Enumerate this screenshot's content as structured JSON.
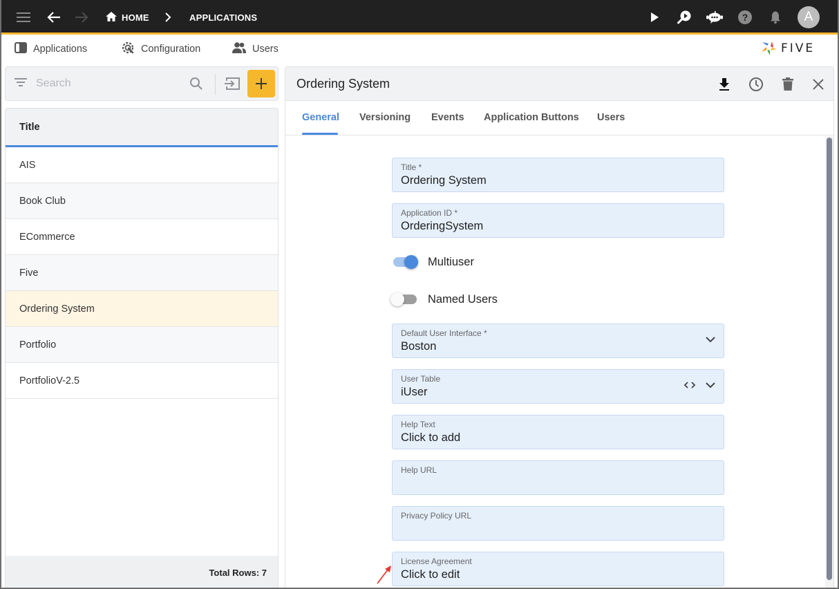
{
  "topbar": {
    "breadcrumb": [
      {
        "label": "HOME",
        "icon": "home-icon"
      },
      {
        "label": "APPLICATIONS"
      }
    ],
    "avatar_initial": "A",
    "icons": [
      "menu-icon",
      "back-arrow-icon",
      "forward-arrow-icon",
      "play-icon",
      "search-play-icon",
      "chat-bot-icon",
      "help-icon",
      "bell-icon"
    ]
  },
  "nav": {
    "items": [
      {
        "label": "Applications",
        "icon": "applications-icon"
      },
      {
        "label": "Configuration",
        "icon": "configuration-icon"
      },
      {
        "label": "Users",
        "icon": "users-icon"
      }
    ],
    "logo_text": "FIVE"
  },
  "list": {
    "search_placeholder": "Search",
    "column_header": "Title",
    "rows": [
      {
        "title": "AIS"
      },
      {
        "title": "Book Club"
      },
      {
        "title": "ECommerce"
      },
      {
        "title": "Five"
      },
      {
        "title": "Ordering System",
        "selected": true
      },
      {
        "title": "Portfolio"
      },
      {
        "title": "PortfolioV-2.5"
      }
    ],
    "footer": "Total Rows: 7"
  },
  "detail": {
    "title": "Ordering System",
    "tabs": [
      {
        "label": "General",
        "active": true
      },
      {
        "label": "Versioning"
      },
      {
        "label": "Events"
      },
      {
        "label": "Application Buttons"
      },
      {
        "label": "Users"
      }
    ],
    "fields": {
      "title": {
        "label": "Title *",
        "value": "Ordering System"
      },
      "app_id": {
        "label": "Application ID *",
        "value": "OrderingSystem"
      },
      "multiuser": {
        "label": "Multiuser",
        "on": true
      },
      "named_users": {
        "label": "Named Users",
        "on": false
      },
      "default_ui": {
        "label": "Default User Interface *",
        "value": "Boston"
      },
      "user_table": {
        "label": "User Table",
        "value": "iUser"
      },
      "help_text": {
        "label": "Help Text",
        "value": "Click to add"
      },
      "help_url": {
        "label": "Help URL",
        "value": ""
      },
      "privacy_url": {
        "label": "Privacy Policy URL",
        "value": ""
      },
      "license": {
        "label": "License Agreement",
        "value": "Click to edit"
      }
    }
  },
  "colors": {
    "accent": "#f5b72c",
    "primary": "#4a89dc",
    "topbar": "#212121",
    "field_bg": "#e6f0fb",
    "selected_row": "#fff5e3",
    "annotation_arrow": "#e53935"
  }
}
